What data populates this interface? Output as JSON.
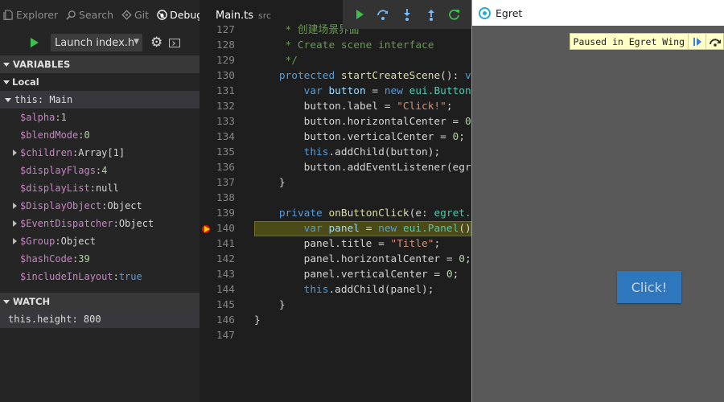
{
  "activity": {
    "explorer": "Explorer",
    "search": "Search",
    "git": "Git",
    "debug": "Debug"
  },
  "launch": {
    "config": "Launch index.h"
  },
  "variables": {
    "header": "VARIABLES",
    "scope": "Local",
    "this_row": "this: Main",
    "items": [
      {
        "name": "$alpha",
        "value": "1",
        "kind": "num",
        "expandable": false
      },
      {
        "name": "$blendMode",
        "value": "0",
        "kind": "num",
        "expandable": false
      },
      {
        "name": "$children",
        "value": "Array[1]",
        "kind": "obj",
        "expandable": true
      },
      {
        "name": "$displayFlags",
        "value": "4",
        "kind": "num",
        "expandable": false
      },
      {
        "name": "$displayList",
        "value": "null",
        "kind": "obj",
        "expandable": false
      },
      {
        "name": "$DisplayObject",
        "value": "Object",
        "kind": "obj",
        "expandable": true
      },
      {
        "name": "$EventDispatcher",
        "value": "Object",
        "kind": "obj",
        "expandable": true
      },
      {
        "name": "$Group",
        "value": "Object",
        "kind": "obj",
        "expandable": true
      },
      {
        "name": "$hashCode",
        "value": "39",
        "kind": "num",
        "expandable": false
      },
      {
        "name": "$includeInLayout",
        "value": "true",
        "kind": "kw",
        "expandable": false
      }
    ]
  },
  "watch": {
    "header": "WATCH",
    "expression": "this.height: 800"
  },
  "editor": {
    "tab_name": "Main.ts",
    "tab_path": "src",
    "current_line": 140,
    "breakpoint_line": 140,
    "lines": [
      {
        "num": "127",
        "tokens": [
          [
            "c",
            "     * 创建场景界面"
          ]
        ]
      },
      {
        "num": "128",
        "tokens": [
          [
            "c",
            "     * Create scene interface"
          ]
        ]
      },
      {
        "num": "129",
        "tokens": [
          [
            "c",
            "     */"
          ]
        ]
      },
      {
        "num": "130",
        "tokens": [
          [
            "p",
            "    "
          ],
          [
            "k",
            "protected "
          ],
          [
            "f",
            "startCreateScene"
          ],
          [
            "p",
            "(): "
          ],
          [
            "k",
            "v"
          ]
        ]
      },
      {
        "num": "131",
        "tokens": [
          [
            "p",
            "        "
          ],
          [
            "k",
            "var "
          ],
          [
            "v",
            "button"
          ],
          [
            "p",
            " = "
          ],
          [
            "k",
            "new "
          ],
          [
            "t",
            "eui.Button"
          ]
        ]
      },
      {
        "num": "132",
        "tokens": [
          [
            "p",
            "        button.label = "
          ],
          [
            "s",
            "\"Click!\""
          ],
          [
            "p",
            ";"
          ]
        ]
      },
      {
        "num": "133",
        "tokens": [
          [
            "p",
            "        button.horizontalCenter = "
          ],
          [
            "n",
            "0"
          ]
        ]
      },
      {
        "num": "134",
        "tokens": [
          [
            "p",
            "        button.verticalCenter = "
          ],
          [
            "n",
            "0"
          ],
          [
            "p",
            ";"
          ]
        ]
      },
      {
        "num": "135",
        "tokens": [
          [
            "p",
            "        "
          ],
          [
            "k",
            "this"
          ],
          [
            "p",
            ".addChild(button);"
          ]
        ]
      },
      {
        "num": "136",
        "tokens": [
          [
            "p",
            "        button.addEventListener(egr"
          ]
        ]
      },
      {
        "num": "137",
        "tokens": [
          [
            "p",
            "    }"
          ]
        ]
      },
      {
        "num": "138",
        "tokens": []
      },
      {
        "num": "139",
        "tokens": [
          [
            "p",
            "    "
          ],
          [
            "k",
            "private "
          ],
          [
            "f",
            "onButtonClick"
          ],
          [
            "p",
            "(e: "
          ],
          [
            "t",
            "egret."
          ]
        ]
      },
      {
        "num": "140",
        "tokens": [
          [
            "p",
            "        "
          ],
          [
            "k",
            "var "
          ],
          [
            "v",
            "panel"
          ],
          [
            "p",
            " = "
          ],
          [
            "k",
            "new "
          ],
          [
            "t",
            "eui.Panel"
          ],
          [
            "p",
            "()"
          ]
        ]
      },
      {
        "num": "141",
        "tokens": [
          [
            "p",
            "        panel.title = "
          ],
          [
            "s",
            "\"Title\""
          ],
          [
            "p",
            ";"
          ]
        ]
      },
      {
        "num": "142",
        "tokens": [
          [
            "p",
            "        panel.horizontalCenter = "
          ],
          [
            "n",
            "0"
          ],
          [
            "p",
            ";"
          ]
        ]
      },
      {
        "num": "143",
        "tokens": [
          [
            "p",
            "        panel.verticalCenter = "
          ],
          [
            "n",
            "0"
          ],
          [
            "p",
            ";"
          ]
        ]
      },
      {
        "num": "144",
        "tokens": [
          [
            "p",
            "        "
          ],
          [
            "k",
            "this"
          ],
          [
            "p",
            ".addChild(panel);"
          ]
        ]
      },
      {
        "num": "145",
        "tokens": [
          [
            "p",
            "    }"
          ]
        ]
      },
      {
        "num": "146",
        "tokens": [
          [
            "p",
            "}"
          ]
        ]
      },
      {
        "num": "147",
        "tokens": []
      }
    ]
  },
  "preview": {
    "title": "Egret",
    "paused_text": "Paused in Egret Wing",
    "button_label": "Click!"
  },
  "colors": {
    "run_green": "#3fbf4f",
    "breakpoint": "#e51400",
    "egret_button": "#2f77bd"
  },
  "icons": [
    "files-icon",
    "search-icon",
    "git-icon",
    "bug-icon",
    "play-icon",
    "gear-icon",
    "console-icon",
    "continue-icon",
    "step-over-icon",
    "step-into-icon",
    "step-out-icon",
    "restart-icon",
    "egret-logo-icon",
    "resume-icon",
    "step-over-small-icon"
  ]
}
